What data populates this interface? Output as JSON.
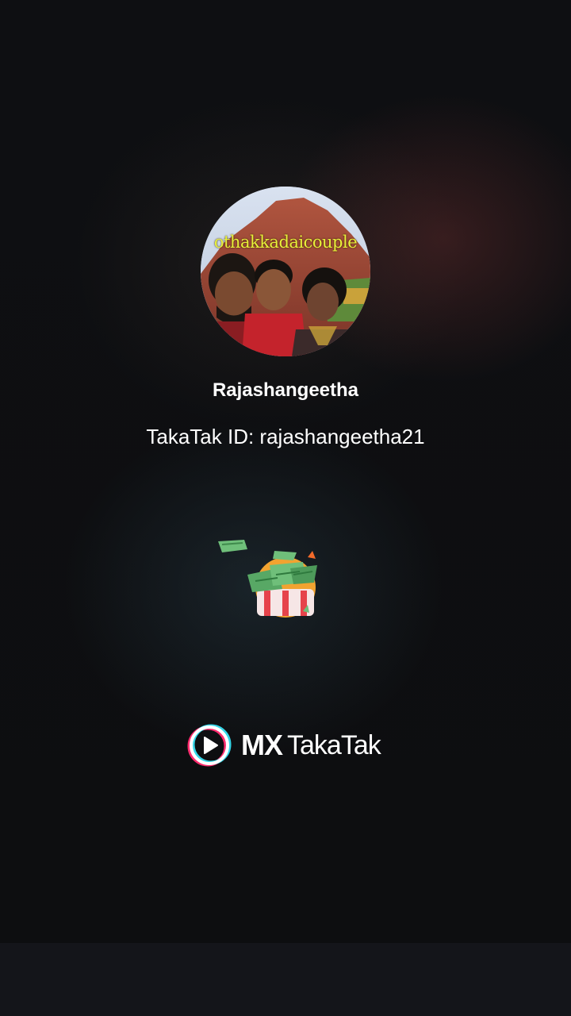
{
  "profile": {
    "avatar_caption": "othakkadaicouple",
    "name": "Rajashangeetha",
    "takatak_id": "TakaTak ID: rajashangeetha21"
  },
  "reward": {
    "icon": "money-gift-icon"
  },
  "brand": {
    "logo_icon": "mx-play-icon",
    "mx": "MX",
    "takatak": "TakaTak"
  },
  "colors": {
    "background": "#0d0e10",
    "text": "#ffffff",
    "caption": "#e9f03a"
  }
}
